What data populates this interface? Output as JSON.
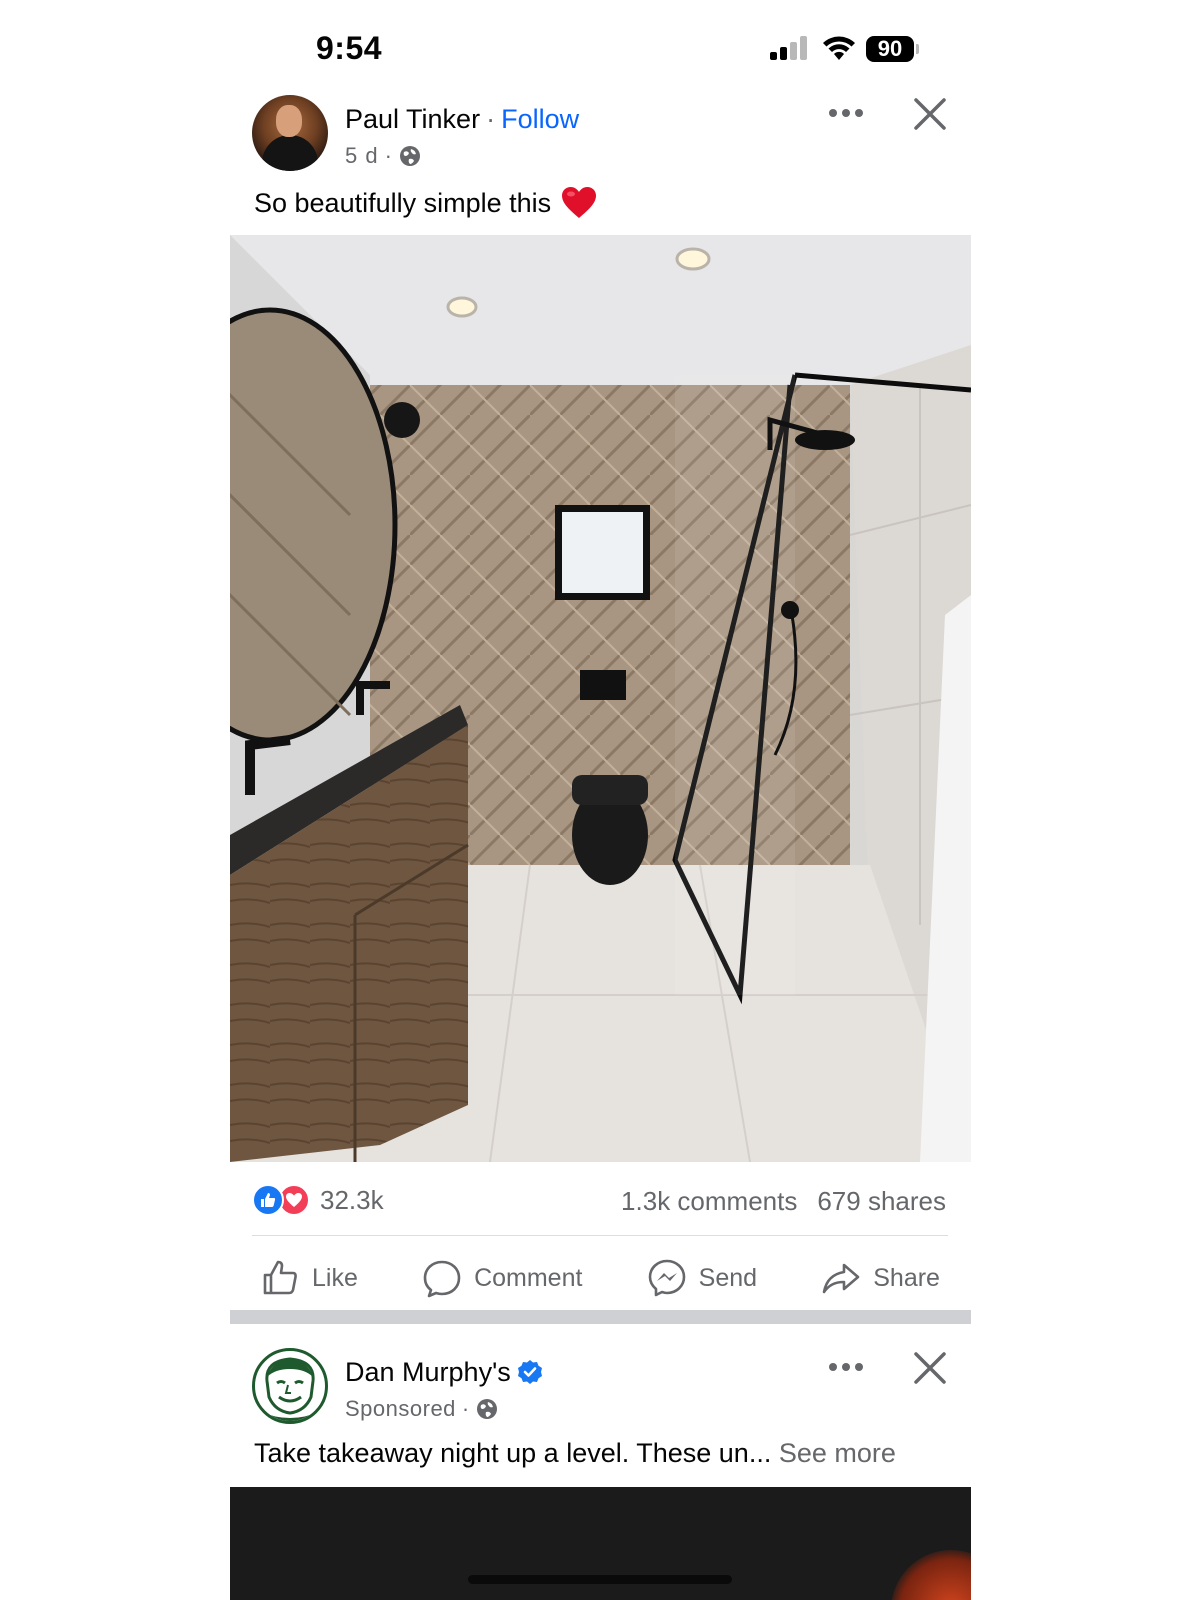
{
  "status_bar": {
    "time": "9:54",
    "battery": "90"
  },
  "post": {
    "author": "Paul Tinker",
    "separator": "·",
    "follow": "Follow",
    "time": "5 d",
    "meta_separator": "·",
    "audience_icon": "globe-icon",
    "caption": "So beautifully simple this",
    "caption_emoji": "heart-emoji",
    "photo_description_icon": "bathroom-photo",
    "reactions": {
      "icons": [
        "like-reaction-icon",
        "love-reaction-icon"
      ],
      "count": "32.3k"
    },
    "comments": "1.3k comments",
    "shares": "679 shares",
    "actions": [
      {
        "label": "Like",
        "icon": "thumbs-up-icon"
      },
      {
        "label": "Comment",
        "icon": "comment-bubble-icon"
      },
      {
        "label": "Send",
        "icon": "messenger-icon"
      },
      {
        "label": "Share",
        "icon": "share-arrow-icon"
      }
    ]
  },
  "ad_post": {
    "author": "Dan Murphy's",
    "verified_icon": "verified-badge-icon",
    "label": "Sponsored",
    "meta_separator": "·",
    "audience_icon": "globe-icon",
    "caption": "Take takeaway night up a level. These un...",
    "see_more": "See more"
  },
  "colors": {
    "accent": "#0866ff",
    "secondary_text": "#65676b",
    "like_blue": "#1877f2",
    "love_red": "#f33e58"
  }
}
